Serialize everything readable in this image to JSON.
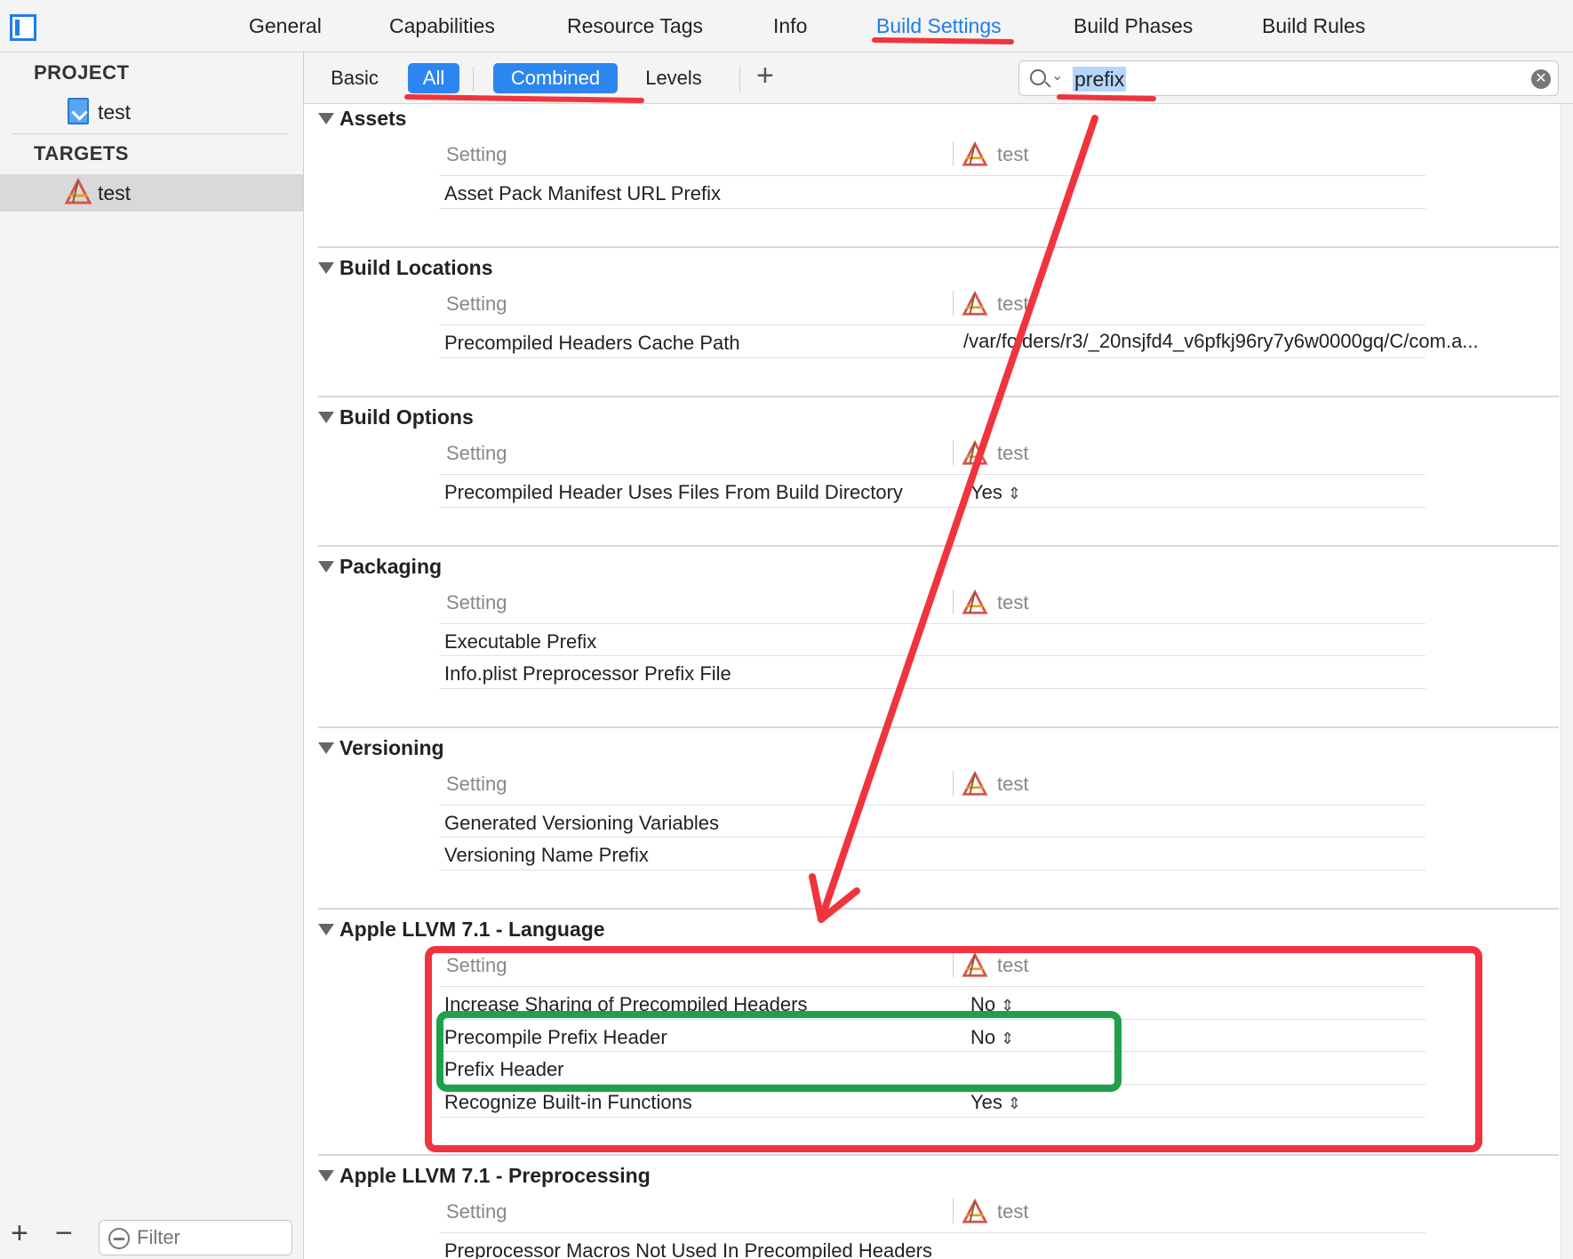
{
  "tabs": [
    "General",
    "Capabilities",
    "Resource Tags",
    "Info",
    "Build Settings",
    "Build Phases",
    "Build Rules"
  ],
  "active_tab": "Build Settings",
  "sidebar": {
    "project_header": "PROJECT",
    "project_item": "test",
    "targets_header": "TARGETS",
    "target_item": "test",
    "filter_placeholder": "Filter"
  },
  "filterbar": {
    "basic": "Basic",
    "all": "All",
    "combined": "Combined",
    "levels": "Levels",
    "add": "+",
    "search_value": "prefix"
  },
  "columns": {
    "setting": "Setting",
    "target": "test"
  },
  "sections": [
    {
      "title": "Assets",
      "rows": [
        {
          "name": "Asset Pack Manifest URL Prefix",
          "value": ""
        }
      ]
    },
    {
      "title": "Build Locations",
      "rows": [
        {
          "name": "Precompiled Headers Cache Path",
          "value": "/var/folders/r3/_20nsjfd4_v6pfkj96ry7y6w0000gq/C/com.a..."
        }
      ]
    },
    {
      "title": "Build Options",
      "rows": [
        {
          "name": "Precompiled Header Uses Files From Build Directory",
          "value": "Yes"
        }
      ]
    },
    {
      "title": "Packaging",
      "rows": [
        {
          "name": "Executable Prefix",
          "value": ""
        },
        {
          "name": "Info.plist Preprocessor Prefix File",
          "value": ""
        }
      ]
    },
    {
      "title": "Versioning",
      "rows": [
        {
          "name": "Generated Versioning Variables",
          "value": ""
        },
        {
          "name": "Versioning Name Prefix",
          "value": ""
        }
      ]
    },
    {
      "title": "Apple LLVM 7.1 - Language",
      "rows": [
        {
          "name": "Increase Sharing of Precompiled Headers",
          "value": "No"
        },
        {
          "name": "Precompile Prefix Header",
          "value": "No"
        },
        {
          "name": "Prefix Header",
          "value": ""
        },
        {
          "name": "Recognize Built-in Functions",
          "value": "Yes"
        }
      ]
    },
    {
      "title": "Apple LLVM 7.1 - Preprocessing",
      "rows": [
        {
          "name": "Preprocessor Macros Not Used In Precompiled Headers",
          "value": ""
        }
      ]
    }
  ],
  "colors": {
    "accent": "#1d7dea",
    "annotation_red": "#f0343e",
    "annotation_green": "#1fa04a"
  }
}
